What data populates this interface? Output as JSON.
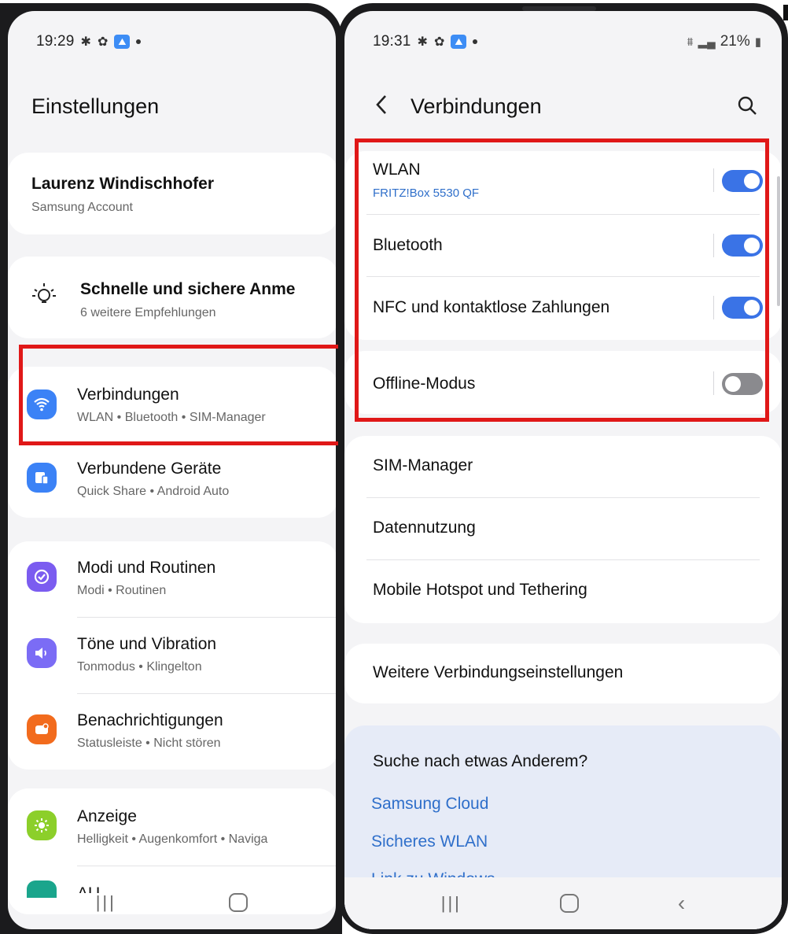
{
  "left": {
    "status": {
      "time": "19:29",
      "app_badge": "⛰"
    },
    "title": "Einstellungen",
    "account": {
      "name": "Laurenz Windischhofer",
      "sub": "Samsung Account"
    },
    "suggestion": {
      "title": "Schnelle und sichere Anme",
      "sub": "6 weitere Empfehlungen"
    },
    "items": [
      {
        "title": "Verbindungen",
        "sub": "WLAN  •  Bluetooth  •  SIM-Manager",
        "icon": "wifi-icon",
        "color": "#3b82f6"
      },
      {
        "title": "Verbundene Geräte",
        "sub": "Quick Share  •  Android Auto",
        "icon": "devices-icon",
        "color": "#3b82f6"
      },
      {
        "title": "Modi und Routinen",
        "sub": "Modi  •  Routinen",
        "icon": "check-circle-icon",
        "color": "#7b5cf0"
      },
      {
        "title": "Töne und Vibration",
        "sub": "Tonmodus  •  Klingelton",
        "icon": "speaker-icon",
        "color": "#7b6cf5"
      },
      {
        "title": "Benachrichtigungen",
        "sub": "Statusleiste  •  Nicht stören",
        "icon": "bell-icon",
        "color": "#f26b1d"
      },
      {
        "title": "Anzeige",
        "sub": "Helligkeit  •  Augenkomfort  •  Naviga",
        "icon": "sun-icon",
        "color": "#8ccf2a"
      },
      {
        "title": "AU",
        "sub": "",
        "icon": "wallpaper-icon",
        "color": "#1aa58c"
      }
    ]
  },
  "right": {
    "status": {
      "time": "19:31",
      "app_badge": "⛰",
      "battery": "21%"
    },
    "title": "Verbindungen",
    "toggles": [
      {
        "title": "WLAN",
        "sub": "FRITZ!Box 5530 QF",
        "on": true
      },
      {
        "title": "Bluetooth",
        "on": true
      },
      {
        "title": "NFC und kontaktlose Zahlungen",
        "on": true
      },
      {
        "title": "Offline-Modus",
        "on": false
      }
    ],
    "menu": [
      "SIM-Manager",
      "Datennutzung",
      "Mobile Hotspot und Tethering"
    ],
    "more": "Weitere Verbindungseinstellungen",
    "suggest": {
      "heading": "Suche nach etwas Anderem?",
      "links": [
        "Samsung Cloud",
        "Sicheres WLAN",
        "Link zu Windows"
      ]
    }
  },
  "colors": {
    "accent": "#3a73e6",
    "highlight": "#e01818",
    "link": "#2f6fca"
  }
}
